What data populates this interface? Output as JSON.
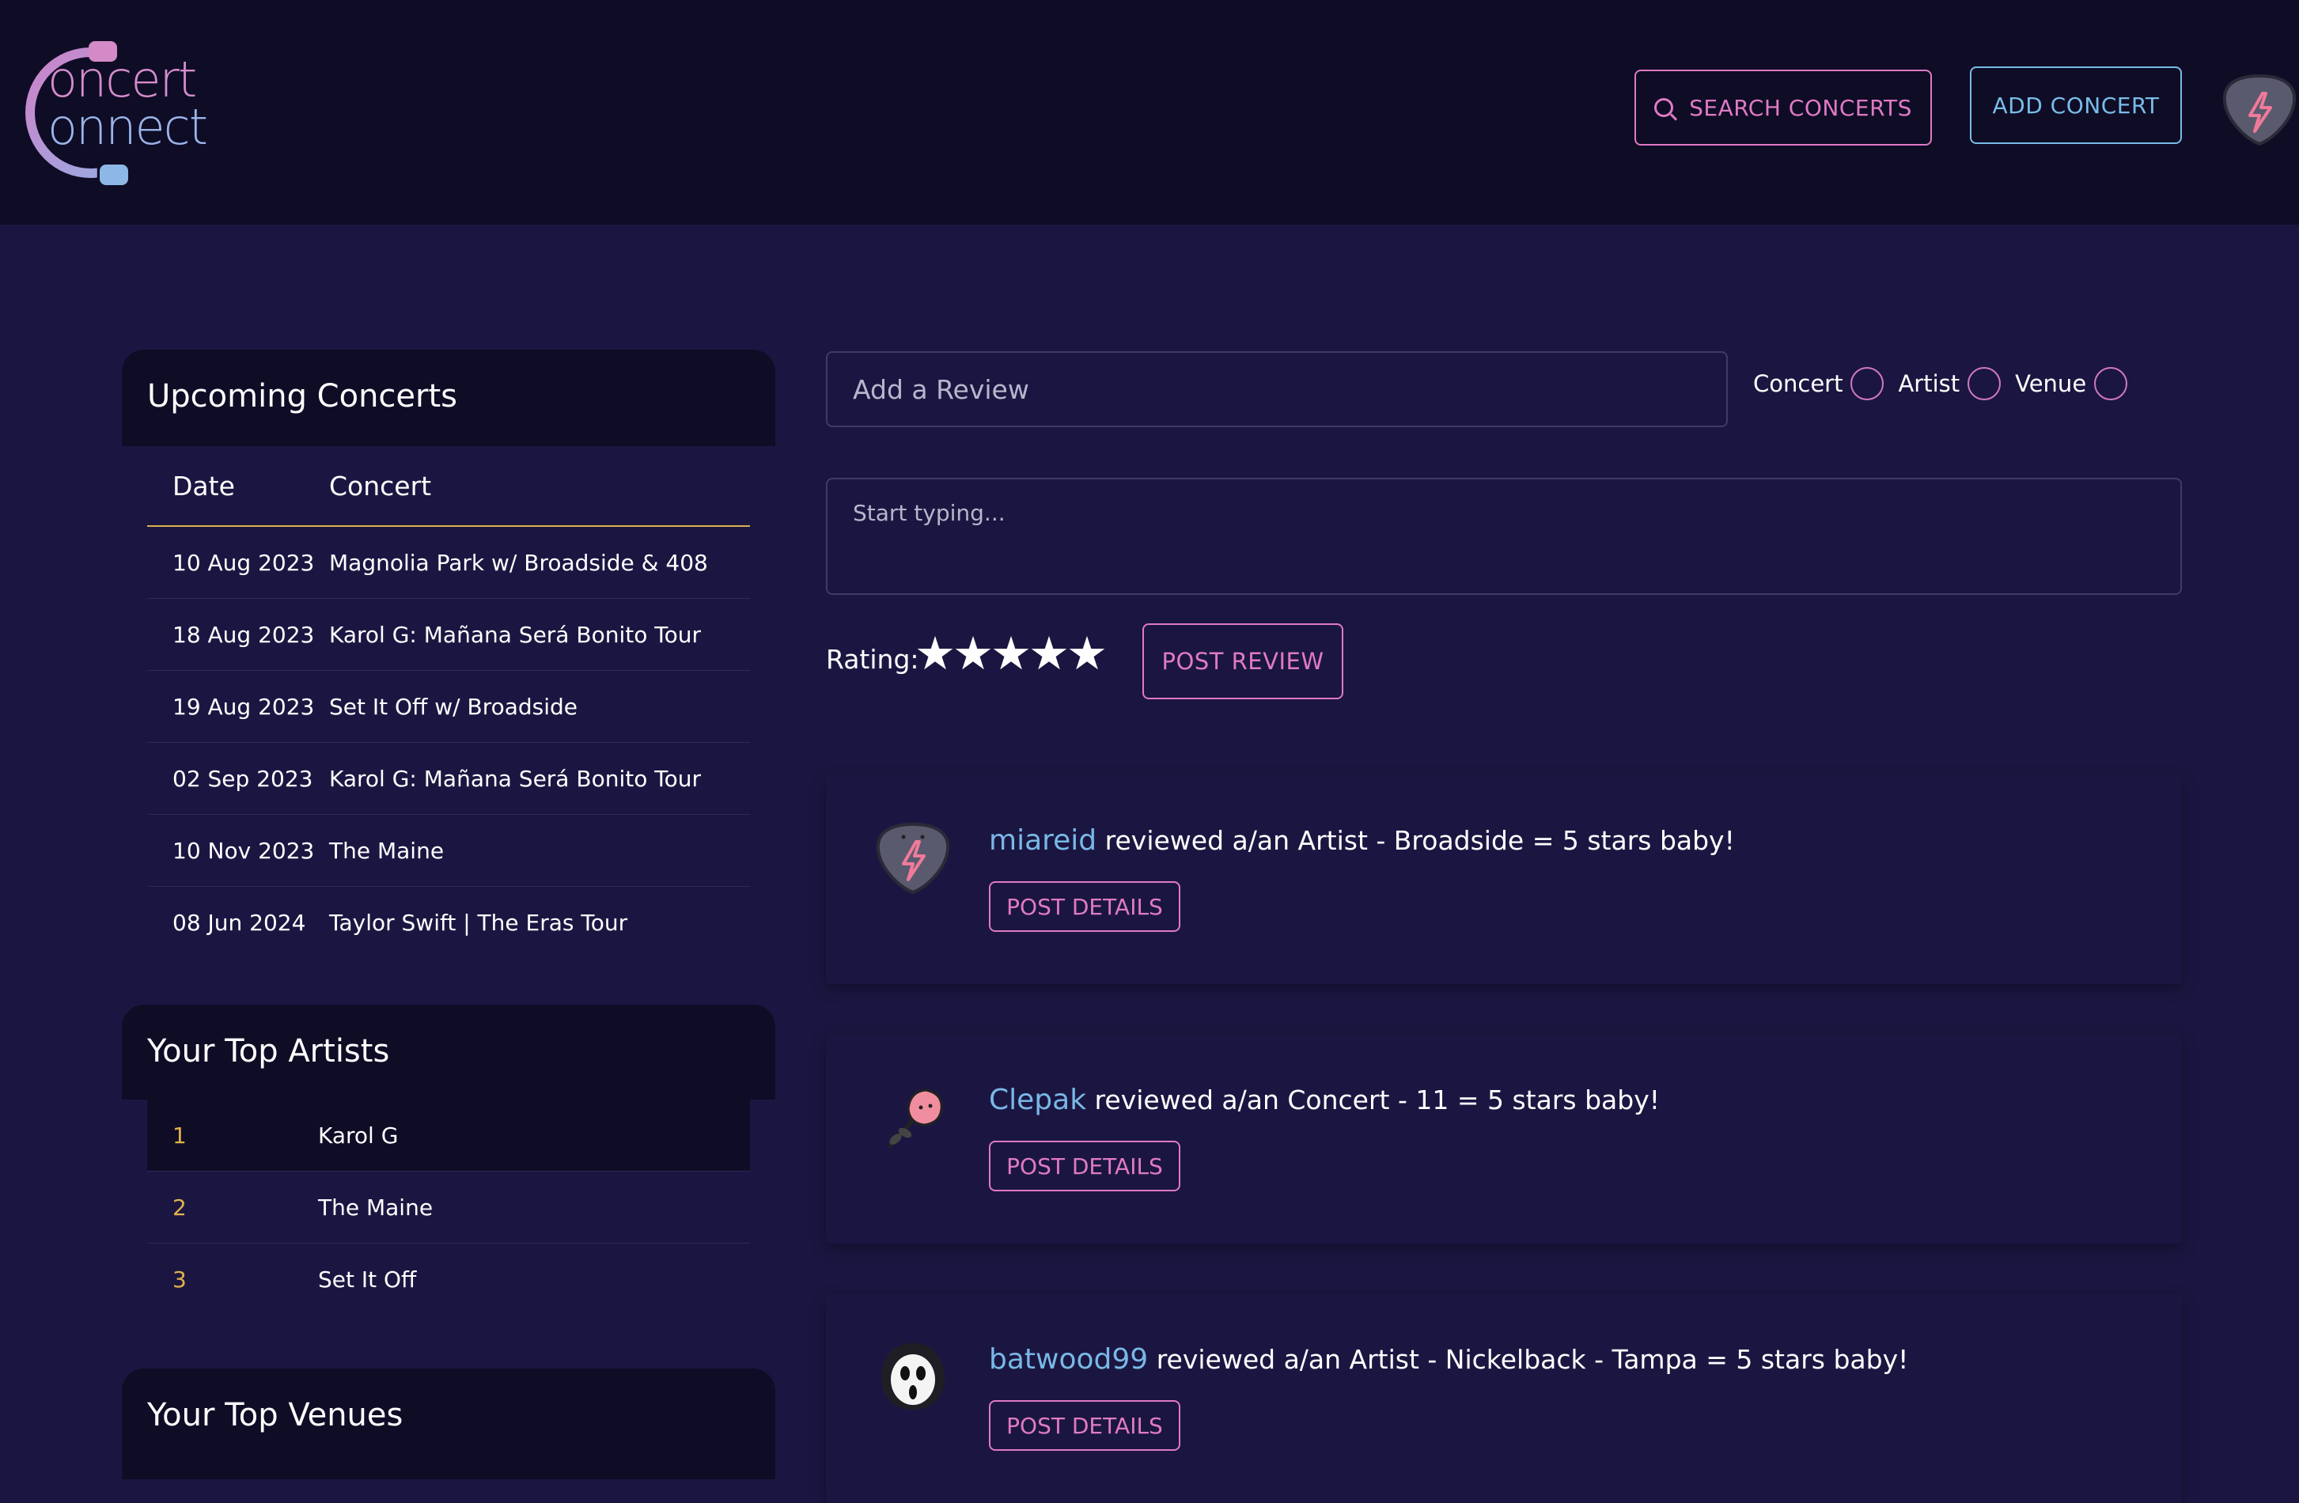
{
  "brand": {
    "logo_line1": "oncert",
    "logo_line2": "onnect"
  },
  "header": {
    "search_label": "SEARCH CONCERTS",
    "add_label": "ADD CONCERT"
  },
  "upcoming": {
    "title": "Upcoming Concerts",
    "columns": [
      "Date",
      "Concert"
    ],
    "rows": [
      {
        "date": "10 Aug 2023",
        "concert": "Magnolia Park w/ Broadside & 408"
      },
      {
        "date": "18 Aug 2023",
        "concert": "Karol G: Mañana Será Bonito Tour"
      },
      {
        "date": "19 Aug 2023",
        "concert": "Set It Off w/ Broadside"
      },
      {
        "date": "02 Sep 2023",
        "concert": "Karol G: Mañana Será Bonito Tour"
      },
      {
        "date": "10 Nov 2023",
        "concert": "The Maine"
      },
      {
        "date": "08 Jun 2024",
        "concert": "Taylor Swift | The Eras Tour"
      }
    ]
  },
  "top_artists": {
    "title": "Your Top Artists",
    "rows": [
      {
        "rank": "1",
        "name": "Karol G"
      },
      {
        "rank": "2",
        "name": "The Maine"
      },
      {
        "rank": "3",
        "name": "Set It Off"
      }
    ]
  },
  "top_venues": {
    "title": "Your Top Venues"
  },
  "review_form": {
    "title_placeholder": "Add a Review",
    "body_placeholder": "Start typing...",
    "types": [
      "Concert",
      "Artist",
      "Venue"
    ],
    "rating_label": "Rating:",
    "stars": "★★★★★",
    "post_label": "POST REVIEW"
  },
  "posts": [
    {
      "user": "miareid",
      "text": "reviewed a/an Artist - Broadside = 5 stars baby!",
      "avatar": "guitar-pick-icon",
      "button": "POST DETAILS"
    },
    {
      "user": "Clepak",
      "text": "reviewed a/an Concert - 11 = 5 stars baby!",
      "avatar": "rose-icon",
      "button": "POST DETAILS"
    },
    {
      "user": "batwood99",
      "text": "reviewed a/an Artist - Nickelback - Tampa = 5 stars baby!",
      "avatar": "ghost-face-icon",
      "button": "POST DETAILS"
    }
  ],
  "colors": {
    "pink": "#e07ac4",
    "blue": "#79b8e6",
    "gold": "#d9b24a",
    "bg": "#1b1641",
    "panel": "#0f0c26"
  }
}
